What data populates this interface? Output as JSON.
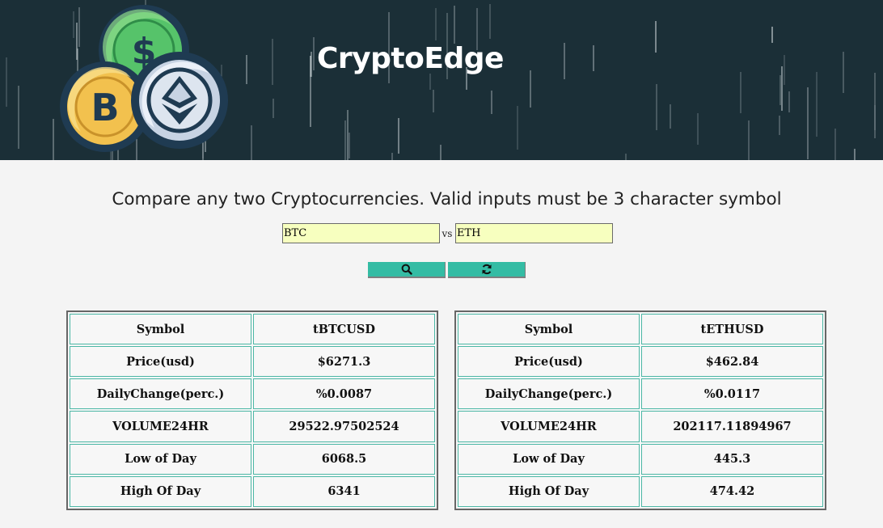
{
  "header": {
    "brand": "CryptoEdge"
  },
  "search": {
    "prompt": "Compare any two Cryptocurrencies. Valid inputs must be 3 character symbol",
    "coin1_value": "BTC",
    "vs_label": "vs",
    "coin2_value": "ETH",
    "search_icon": "search-icon",
    "refresh_icon": "refresh-icon"
  },
  "tables": {
    "left": [
      {
        "label": "Symbol",
        "value": "tBTCUSD"
      },
      {
        "label": "Price(usd)",
        "value": "$6271.3"
      },
      {
        "label": "DailyChange(perc.)",
        "value": "%0.0087"
      },
      {
        "label": "VOLUME24HR",
        "value": "29522.97502524"
      },
      {
        "label": "Low of Day",
        "value": "6068.5"
      },
      {
        "label": "High Of Day",
        "value": "6341"
      }
    ],
    "right": [
      {
        "label": "Symbol",
        "value": "tETHUSD"
      },
      {
        "label": "Price(usd)",
        "value": "$462.84"
      },
      {
        "label": "DailyChange(perc.)",
        "value": "%0.0117"
      },
      {
        "label": "VOLUME24HR",
        "value": "202117.11894967"
      },
      {
        "label": "Low of Day",
        "value": "445.3"
      },
      {
        "label": "High Of Day",
        "value": "474.42"
      }
    ]
  },
  "colors": {
    "header_bg": "#1b2f37",
    "button": "#34bca4",
    "input_bg": "#f7ffbf",
    "cell_border": "#4bb7a5"
  }
}
